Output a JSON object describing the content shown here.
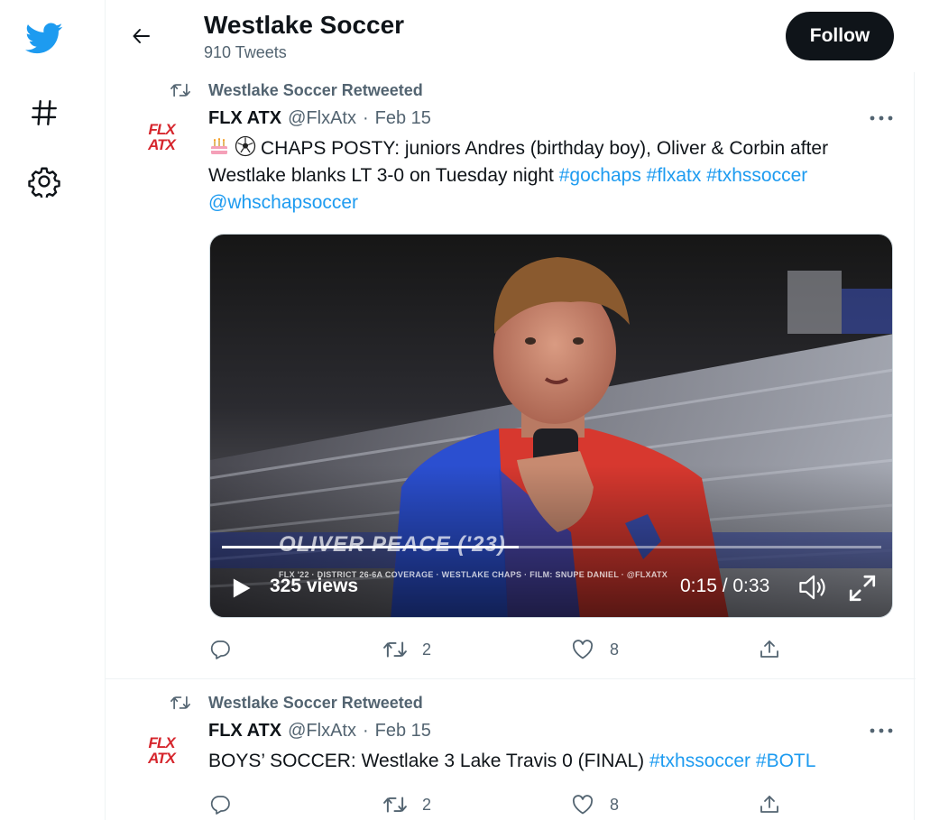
{
  "nav": {
    "logo_icon": "twitter-bird-icon",
    "explore_icon": "hashtag-icon",
    "settings_icon": "gear-icon",
    "brand_color": "#1d9bf0"
  },
  "header": {
    "title": "Westlake Soccer",
    "subtitle": "910 Tweets",
    "follow_label": "Follow"
  },
  "tweets": [
    {
      "retweeted_by": "Westlake Soccer Retweeted",
      "avatar_text": "FLX ATX",
      "author_name": "FLX ATX",
      "handle": "@FlxAtx",
      "separator": "·",
      "date": "Feb 15",
      "emoji": [
        "birthday-cake-emoji",
        "soccer-ball-emoji"
      ],
      "text_before": "CHAPS POSTY: juniors Andres (birthday boy), Oliver & Corbin after Westlake blanks LT 3-0 on Tuesday night",
      "hashtags": [
        "#gochaps",
        "#flxatx",
        "#txhssoccer"
      ],
      "mention": "@whschapsoccer",
      "video": {
        "overlay_name": "OLIVER PEACE ('23)",
        "overlay_credit": "FLX '22 · DISTRICT 26-6A COVERAGE · WESTLAKE CHAPS · FILM: SNUPE DANIEL · @FLXATX",
        "views": "325 views",
        "time": "0:15 / 0:33",
        "progress": 0.45
      },
      "replies": "",
      "retweets": "2",
      "likes": "8"
    },
    {
      "retweeted_by": "Westlake Soccer Retweeted",
      "avatar_text": "FLX ATX",
      "author_name": "FLX ATX",
      "handle": "@FlxAtx",
      "separator": "·",
      "date": "Feb 15",
      "text_before": "BOYS’ SOCCER: Westlake 3 Lake Travis 0 (FINAL)",
      "hashtags": [
        "#txhssoccer",
        "#BOTL"
      ],
      "replies": "",
      "retweets": "2",
      "likes": "8"
    }
  ]
}
